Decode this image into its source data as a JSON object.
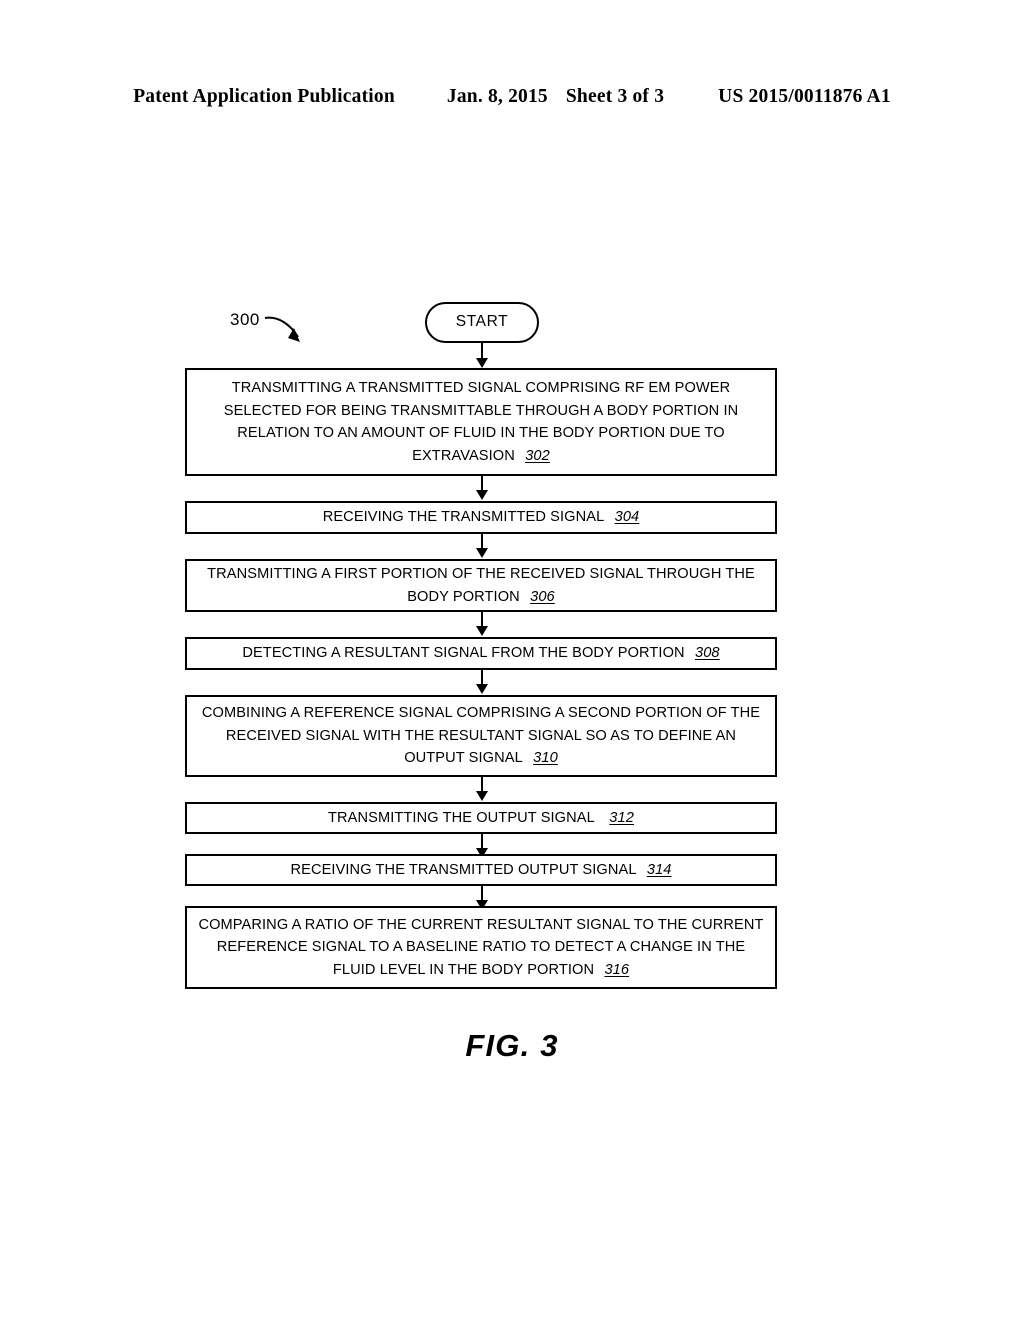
{
  "header": {
    "publication_type": "Patent Application Publication",
    "date": "Jan. 8, 2015",
    "sheet": "Sheet 3 of 3",
    "publication_number": "US 2015/0011876 A1"
  },
  "figure": {
    "caption": "FIG. 3",
    "diagram_number": "300",
    "callout_arrow_name": "curved-arrow-icon"
  },
  "flowchart": {
    "start": {
      "label": "START"
    },
    "steps": [
      {
        "text": "TRANSMITTING A TRANSMITTED SIGNAL COMPRISING RF EM POWER SELECTED FOR BEING TRANSMITTABLE THROUGH A BODY PORTION IN RELATION TO AN AMOUNT OF FLUID IN THE BODY PORTION DUE TO EXTRAVASION",
        "ref": "302"
      },
      {
        "text": "RECEIVING THE TRANSMITTED SIGNAL",
        "ref": "304"
      },
      {
        "text": "TRANSMITTING A FIRST PORTION OF THE RECEIVED SIGNAL THROUGH THE BODY PORTION",
        "ref": "306"
      },
      {
        "text": "DETECTING A RESULTANT SIGNAL FROM THE BODY PORTION",
        "ref": "308"
      },
      {
        "text": "COMBINING A REFERENCE SIGNAL COMPRISING A SECOND PORTION OF THE RECEIVED SIGNAL WITH THE RESULTANT SIGNAL SO AS TO DEFINE AN OUTPUT SIGNAL",
        "ref": "310"
      },
      {
        "text": "TRANSMITTING THE OUTPUT SIGNAL",
        "ref": "312"
      },
      {
        "text": "RECEIVING THE TRANSMITTED OUTPUT SIGNAL",
        "ref": "314"
      },
      {
        "text": "COMPARING A RATIO OF THE CURRENT RESULTANT SIGNAL TO THE CURRENT REFERENCE SIGNAL TO A BASELINE RATIO TO DETECT A CHANGE IN THE FLUID LEVEL IN THE BODY PORTION",
        "ref": "316"
      }
    ]
  },
  "colors": {
    "ink": "#000000",
    "paper": "#ffffff"
  }
}
